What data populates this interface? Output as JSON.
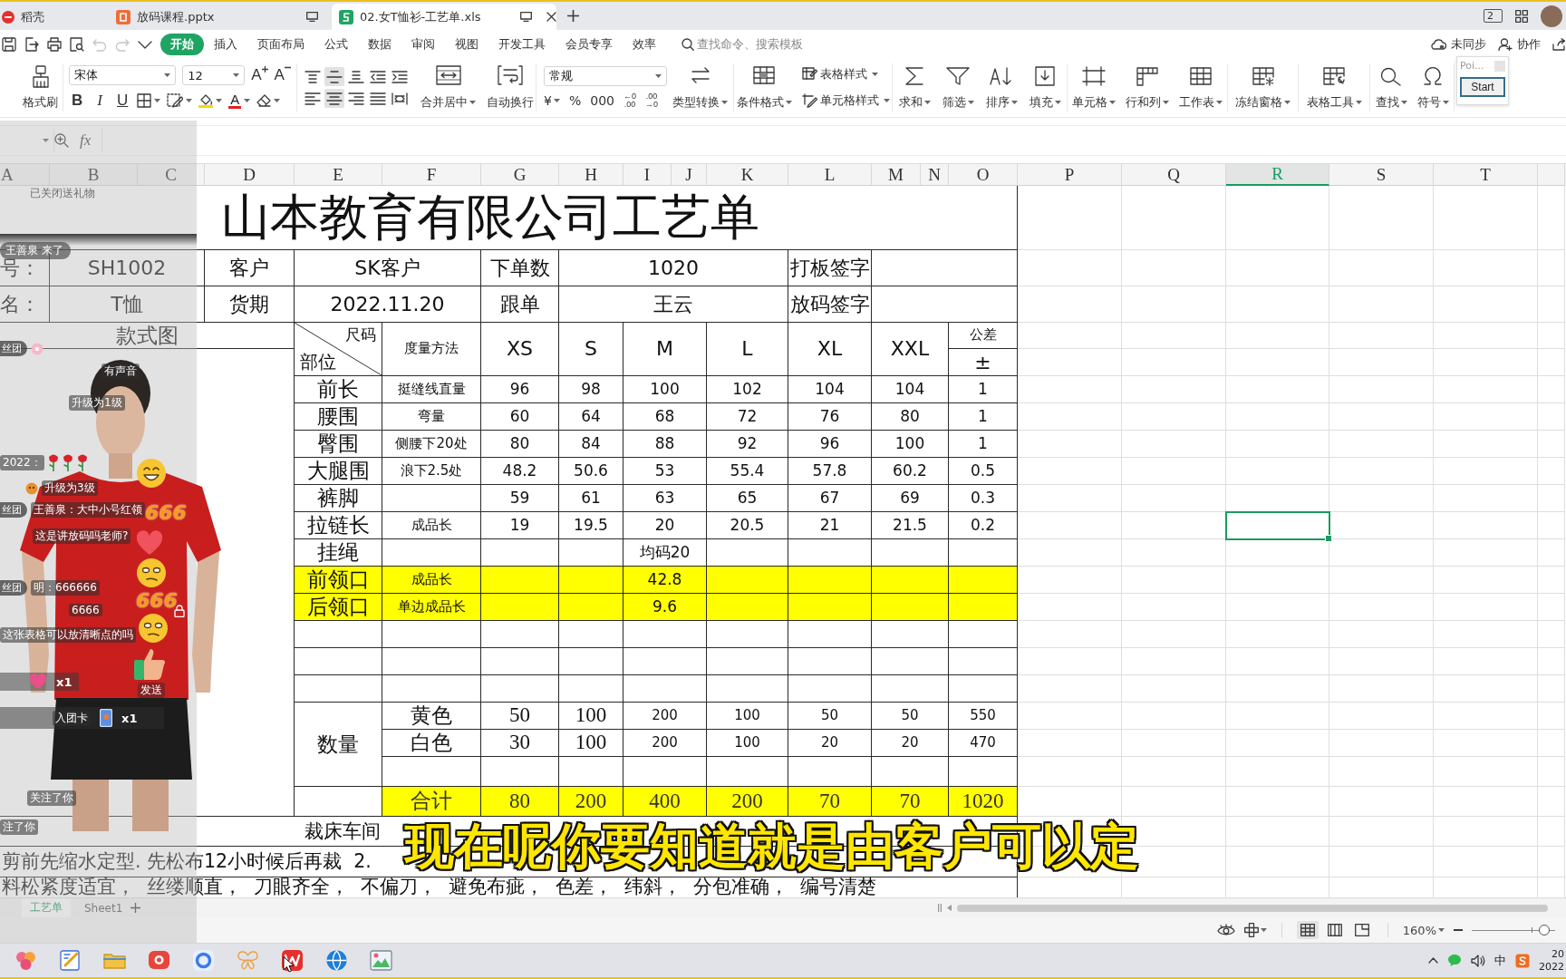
{
  "tabs": [
    {
      "label": "稻壳",
      "kind": "home",
      "selected": false
    },
    {
      "label": "放码课程.pptx",
      "kind": "slides",
      "selected": false
    },
    {
      "label": "02.女T恤衫-工艺单.xls",
      "kind": "sheet",
      "selected": true
    }
  ],
  "window_count": "2",
  "quick_access": [
    {
      "kind": "save",
      "disabled": false
    },
    {
      "kind": "export",
      "disabled": false
    },
    {
      "kind": "print",
      "disabled": false
    },
    {
      "kind": "preview",
      "disabled": false
    },
    {
      "kind": "undo",
      "disabled": true
    },
    {
      "kind": "redo",
      "disabled": true
    },
    {
      "kind": "more",
      "disabled": false
    }
  ],
  "menu": [
    {
      "label": "开始",
      "selected": true
    },
    {
      "label": "插入",
      "selected": false
    },
    {
      "label": "页面布局",
      "selected": false
    },
    {
      "label": "公式",
      "selected": false
    },
    {
      "label": "数据",
      "selected": false
    },
    {
      "label": "审阅",
      "selected": false
    },
    {
      "label": "视图",
      "selected": false
    },
    {
      "label": "开发工具",
      "selected": false
    },
    {
      "label": "会员专享",
      "selected": false
    },
    {
      "label": "效率",
      "selected": false
    }
  ],
  "search": {
    "placeholder": "查找命令、搜索模板"
  },
  "sync_status": "未同步",
  "collaborate": "协作",
  "ribbon": {
    "format_painter": "格式刷",
    "font": "宋体",
    "font_size": "12",
    "font_size_buttons": [
      {
        "kind": "grow",
        "glyph": "A"
      },
      {
        "kind": "shrink",
        "glyph": "A"
      }
    ],
    "text_styles": [
      {
        "kind": "bold",
        "glyph": "B"
      },
      {
        "kind": "italic",
        "glyph": "I"
      },
      {
        "kind": "underline",
        "glyph": "U"
      }
    ],
    "font_color_glyph": "A",
    "align_top": [
      {
        "kind": "top",
        "selected": false
      },
      {
        "kind": "middle",
        "selected": true
      },
      {
        "kind": "bottom",
        "selected": false
      },
      {
        "kind": "outdent",
        "selected": false
      },
      {
        "kind": "indent",
        "selected": false
      }
    ],
    "align_bottom": [
      {
        "kind": "left",
        "selected": false
      },
      {
        "kind": "center",
        "selected": true
      },
      {
        "kind": "right",
        "selected": false
      },
      {
        "kind": "justify",
        "selected": false
      },
      {
        "kind": "distributed",
        "selected": false
      }
    ],
    "merge": "合并居中",
    "wrap": "自动换行",
    "number_format": "常规",
    "currency": "¥",
    "percent": "%",
    "thousands": "000",
    "decimal_buttons": [
      {
        "top": "←0",
        "bottom": ".00"
      },
      {
        "top": ".00",
        "bottom": "→0"
      }
    ],
    "convert": "类型转换",
    "conditional": "条件格式",
    "table_style": "表格样式",
    "cell_style": "单元格样式",
    "tool_groups": [
      [
        {
          "kind": "sum",
          "label": "求和"
        },
        {
          "kind": "filter",
          "label": "筛选"
        },
        {
          "kind": "sort",
          "label": "排序"
        },
        {
          "kind": "fill",
          "label": "填充"
        }
      ],
      [
        {
          "kind": "cell",
          "label": "单元格"
        },
        {
          "kind": "rowcol",
          "label": "行和列"
        },
        {
          "kind": "sheet",
          "label": "工作表"
        }
      ],
      [
        {
          "kind": "freeze",
          "label": "冻结窗格"
        }
      ],
      [
        {
          "kind": "tabletools",
          "label": "表格工具"
        }
      ],
      [
        {
          "kind": "find",
          "label": "查找"
        },
        {
          "kind": "symbol",
          "label": "符号"
        }
      ]
    ]
  },
  "popup": {
    "title": "Poi...",
    "button": "Start"
  },
  "formula_bar": {
    "fx": "fx"
  },
  "columns": [
    {
      "label": "A",
      "selected": false
    },
    {
      "label": "B",
      "selected": false
    },
    {
      "label": "C",
      "selected": false
    },
    {
      "label": "D",
      "selected": false
    },
    {
      "label": "E",
      "selected": false
    },
    {
      "label": "F",
      "selected": false
    },
    {
      "label": "G",
      "selected": false
    },
    {
      "label": "H",
      "selected": false
    },
    {
      "label": "I",
      "selected": false
    },
    {
      "label": "J",
      "selected": false
    },
    {
      "label": "K",
      "selected": false
    },
    {
      "label": "L",
      "selected": false
    },
    {
      "label": "M",
      "selected": false
    },
    {
      "label": "N",
      "selected": false
    },
    {
      "label": "O",
      "selected": false
    },
    {
      "label": "P",
      "selected": false
    },
    {
      "label": "Q",
      "selected": false
    },
    {
      "label": "R",
      "selected": true
    },
    {
      "label": "S",
      "selected": false
    },
    {
      "label": "T",
      "selected": false
    }
  ],
  "sheet": {
    "title": "山本教育有限公司工艺单",
    "order_info": [
      [
        "号：",
        "SH1002",
        "客户",
        "SK客户",
        "下单数",
        "1020",
        "打板签字"
      ],
      [
        "名：",
        "T恤",
        "货期",
        "2022.11.20",
        "跟单",
        "王云",
        "放码签字"
      ]
    ],
    "style_image_label": "款式图",
    "size_header": {
      "size_label": "尺码",
      "part_label": "部位",
      "method_label": "度量方法",
      "sizes": [
        "XS",
        "S",
        "M",
        "L",
        "XL",
        "XXL"
      ],
      "tolerance_label": "公差",
      "tolerance_sign": "±"
    },
    "measurements": [
      {
        "part": "前长",
        "method": "挺缝线直量",
        "values": [
          "96",
          "98",
          "100",
          "102",
          "104",
          "104"
        ],
        "tolerance": "1",
        "highlighted": false
      },
      {
        "part": "腰围",
        "method": "弯量",
        "values": [
          "60",
          "64",
          "68",
          "72",
          "76",
          "80"
        ],
        "tolerance": "1",
        "highlighted": false
      },
      {
        "part": "臀围",
        "method": "侧腰下20处",
        "values": [
          "80",
          "84",
          "88",
          "92",
          "96",
          "100"
        ],
        "tolerance": "1",
        "highlighted": false
      },
      {
        "part": "大腿围",
        "method": "浪下2.5处",
        "values": [
          "48.2",
          "50.6",
          "53",
          "55.4",
          "57.8",
          "60.2"
        ],
        "tolerance": "0.5",
        "highlighted": false
      },
      {
        "part": "裤脚",
        "values": [
          "59",
          "61",
          "63",
          "65",
          "67",
          "69"
        ],
        "tolerance": "0.3",
        "highlighted": false
      },
      {
        "part": "拉链长",
        "method": "成品长",
        "values": [
          "19",
          "19.5",
          "20",
          "20.5",
          "21",
          "21.5"
        ],
        "tolerance": "0.2",
        "highlighted": false
      },
      {
        "part": "挂绳",
        "single_value": "均码20",
        "highlighted": false
      },
      {
        "part": "前领口",
        "method": "成品长",
        "single_value": "42.8",
        "highlighted": true
      },
      {
        "part": "后领口",
        "method": "单边成品长",
        "single_value": "9.6",
        "highlighted": true
      }
    ],
    "quantity": {
      "label": "数量",
      "rows": [
        {
          "name": "黄色",
          "values": [
            "50",
            "100",
            "200",
            "100",
            "50",
            "50"
          ],
          "total": "550"
        },
        {
          "name": "白色",
          "values": [
            "30",
            "100",
            "200",
            "100",
            "20",
            "20"
          ],
          "total": "470"
        }
      ]
    },
    "sum": {
      "label": "合计",
      "values": [
        "80",
        "200",
        "400",
        "200",
        "70",
        "70"
      ],
      "total": "1020",
      "highlighted": true
    },
    "cutting": {
      "label": "裁床车间",
      "notes": [
        "剪前先缩水定型. 先松布12小时候后再裁  2.",
        "料松紧度适宜，  丝缕顺直，  刀眼齐全，  不偏刀，  避免布疵，  色差，  纬斜，  分包准确，  编号清楚"
      ]
    }
  },
  "live_overlay": {
    "gift_notice": "已关闭送礼物",
    "chat": [
      {
        "kind": "join",
        "text": "王善泉 来了"
      },
      {
        "kind": "badge",
        "badge": "丝团"
      },
      {
        "kind": "text",
        "text": "有声音"
      },
      {
        "kind": "text",
        "text": "升级为1级"
      },
      {
        "kind": "roses",
        "text": "2022："
      },
      {
        "kind": "level",
        "text": "升级为3级"
      },
      {
        "kind": "fan",
        "badge": "丝团",
        "text": "王善泉：大中小号红领"
      },
      {
        "kind": "text",
        "text": "这是讲放码吗老师?"
      },
      {
        "kind": "fan",
        "badge": "丝团",
        "text": "明：666666"
      },
      {
        "kind": "locked",
        "text": "6666"
      },
      {
        "kind": "text",
        "text": "这张表格可以放清晰点的吗"
      },
      {
        "kind": "gift",
        "text": "x1"
      },
      {
        "kind": "card",
        "label": "入团卡",
        "text": "x1"
      },
      {
        "kind": "text",
        "text": "关注了你"
      },
      {
        "kind": "text",
        "text": "注了你"
      }
    ],
    "send": "发送",
    "stickers": [
      {
        "kind": "laugh"
      },
      {
        "kind": "digits",
        "text": "666"
      },
      {
        "kind": "heart"
      },
      {
        "kind": "smirk"
      },
      {
        "kind": "digits",
        "text": "666"
      },
      {
        "kind": "smirk"
      },
      {
        "kind": "thumb"
      }
    ]
  },
  "subtitle": "现在呢你要知道就是由客户可以定",
  "sheet_tabs": [
    {
      "label": "工艺单",
      "selected": true
    },
    {
      "label": "Sheet1",
      "selected": false
    }
  ],
  "status_bar": {
    "views": [
      {
        "kind": "normal",
        "selected": true
      },
      {
        "kind": "layout",
        "selected": false
      },
      {
        "kind": "break",
        "selected": false
      }
    ],
    "zoom": "160%",
    "zoom_slider": {
      "level": 0.87
    }
  },
  "taskbar": {
    "apps": [
      {
        "kind": "petal"
      },
      {
        "kind": "notes"
      },
      {
        "kind": "folder"
      },
      {
        "kind": "recorder"
      },
      {
        "kind": "ring"
      },
      {
        "kind": "butterfly"
      },
      {
        "kind": "zigzag"
      },
      {
        "kind": "globe"
      },
      {
        "kind": "picture"
      }
    ],
    "ime": "中",
    "clock": [
      "20",
      "2022"
    ]
  }
}
